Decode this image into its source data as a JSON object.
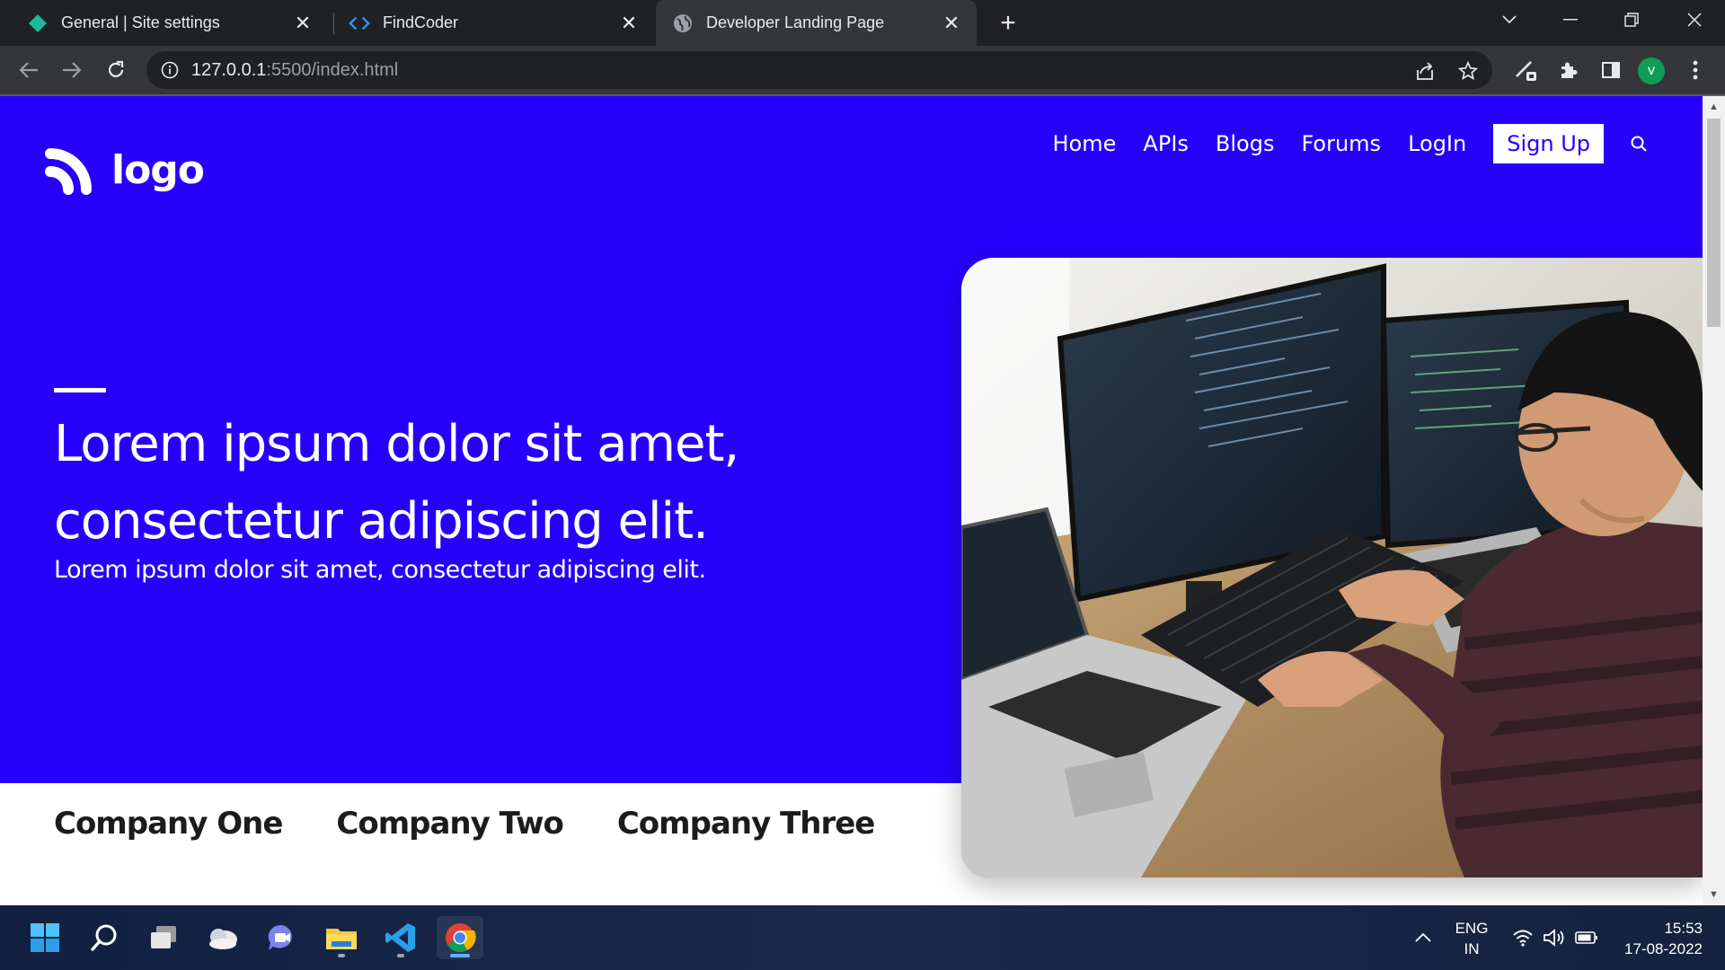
{
  "browser": {
    "tabs": [
      {
        "title": "General | Site settings",
        "icon": "diamond-icon"
      },
      {
        "title": "FindCoder",
        "icon": "code-icon"
      },
      {
        "title": "Developer Landing Page",
        "icon": "globe-icon",
        "active": true
      }
    ],
    "url_host": "127.0.0.1",
    "url_rest": ":5500/index.html",
    "profile_initial": "v"
  },
  "page": {
    "logo_text": "logo",
    "nav": [
      "Home",
      "APIs",
      "Blogs",
      "Forums",
      "LogIn"
    ],
    "signup_label": "Sign Up",
    "hero_title": "Lorem ipsum dolor sit amet, consectetur adipiscing elit.",
    "hero_subtitle": "Lorem ipsum dolor sit amet, consectetur adipiscing elit.",
    "companies": [
      "Company One",
      "Company Two",
      "Company Three"
    ],
    "colors": {
      "hero_bg": "#2700fc",
      "signup_text": "#2700fc"
    }
  },
  "taskbar": {
    "apps": [
      "start-icon",
      "search-icon",
      "task-view-icon",
      "widgets-icon",
      "chat-icon",
      "file-explorer-icon",
      "vscode-icon",
      "chrome-icon"
    ],
    "lang_line1": "ENG",
    "lang_line2": "IN",
    "time": "15:53",
    "date": "17-08-2022"
  }
}
